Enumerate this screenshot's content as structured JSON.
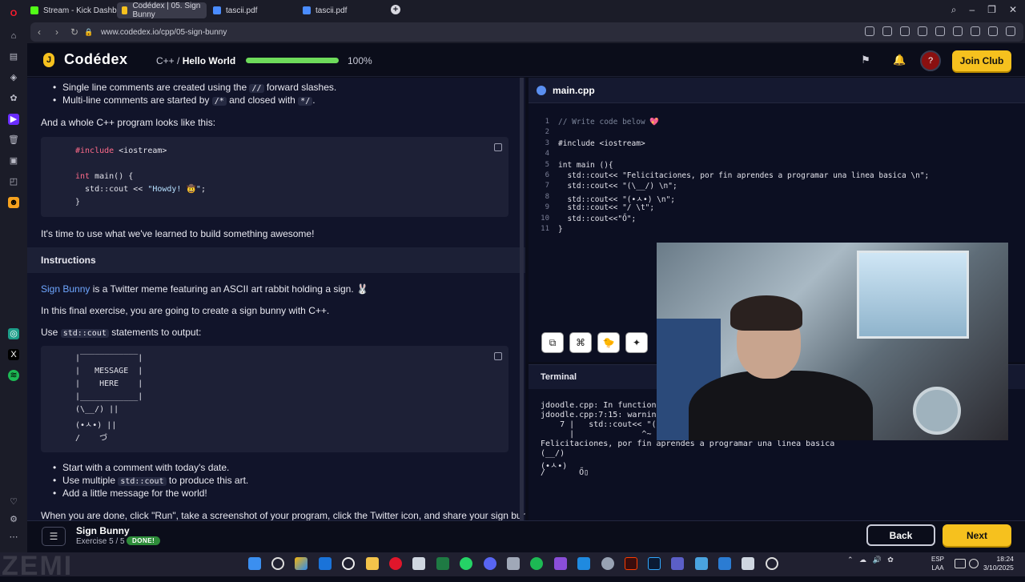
{
  "browser": {
    "tabs": [
      {
        "label": "Stream - Kick Dashboard"
      },
      {
        "label": "Codédex | 05. Sign Bunny"
      },
      {
        "label": "tascii.pdf"
      },
      {
        "label": "tascii.pdf"
      }
    ],
    "url": "www.codedex.io/cpp/05-sign-bunny"
  },
  "header": {
    "logo_badge": "J",
    "logo": "Codédex",
    "course": "C++",
    "separator": "/",
    "chapter": "Hello World",
    "progress_fraction": 1.0,
    "progress_label": "100%",
    "avatar": "?",
    "join_label": "Join Club"
  },
  "lesson": {
    "bullets_top": [
      {
        "pre": "Single line comments are created using the ",
        "code": "//",
        "post": " forward slashes."
      },
      {
        "pre": "Multi-line comments are started by ",
        "code": "/*",
        "mid": " and closed with ",
        "code2": "*/",
        "post": "."
      }
    ],
    "program_intro": "And a whole C++ program looks like this:",
    "program_code": [
      "#include <iostream>",
      "",
      "int main() {",
      "  std::cout << \"Howdy! 🤠\";",
      "}"
    ],
    "awesome": "It's time to use what we've learned to build something awesome!",
    "instructions_title": "Instructions",
    "sign_bunny_link": "Sign Bunny",
    "sign_bunny_text": " is a Twitter meme featuring an ASCII art rabbit holding a sign. 🐰",
    "final_exercise": "In this final exercise, you are going to create a sign bunny with C++.",
    "use_pre": "Use ",
    "use_code": "std::cout",
    "use_post": " statements to output:",
    "art": [
      "|‾‾‾‾‾‾‾‾‾‾‾‾|",
      "|   MESSAGE  |",
      "|    HERE    |",
      "|____________|",
      "(\\__/) ||",
      "(•ㅅ•) ||",
      "/    づ"
    ],
    "bullets_bottom": [
      {
        "pre": "Start with a comment with today's date."
      },
      {
        "pre": "Use multiple ",
        "code": "std::cout",
        "post": " to produce this art."
      },
      {
        "pre": "Add a little message for the world!"
      }
    ],
    "when_done": "When you are done, click \"Run\", take a screenshot of your program, click the Twitter icon, and share your sign bunny!"
  },
  "editor": {
    "filename": "main.cpp",
    "lines": [
      {
        "n": "1",
        "text": "// Write code below 💖",
        "comment": true
      },
      {
        "n": "2",
        "text": ""
      },
      {
        "n": "3",
        "text": "#include <iostream>"
      },
      {
        "n": "4",
        "text": ""
      },
      {
        "n": "5",
        "text": "int main (){"
      },
      {
        "n": "6",
        "text": "  std::cout<< \"Felicitaciones, por fin aprendes a programar una linea basica \\n\";"
      },
      {
        "n": "7",
        "text": "  std::cout<< \"(\\__/) \\n\";"
      },
      {
        "n": "8",
        "text": "  std::cout<< \"(•ㅅ•) \\n\";"
      },
      {
        "n": "9",
        "text": "  std::cout<< \"/ \\t\";"
      },
      {
        "n": "10",
        "text": "  std::cout<<\"Ő\";"
      },
      {
        "n": "11",
        "text": "}"
      }
    ],
    "tool_icons": [
      "copy-icon",
      "camera-icon",
      "duck-icon",
      "sparkle-icon"
    ]
  },
  "terminal": {
    "title": "Terminal",
    "lines": [
      "jdoodle.cpp: In function",
      "jdoodle.cpp:7:15: warning",
      "    7 |   std::cout<< \"(",
      "      |              ^~",
      "Felicitaciones, por fin aprendes a programar una linea basica",
      "(__/)",
      "(•ㅅ•)",
      "/       Ő▯"
    ]
  },
  "footer": {
    "exercise_title": "Sign Bunny",
    "exercise_sub": "Exercise 5 / 5",
    "done_badge": "DONE!",
    "back_label": "Back",
    "next_label": "Next"
  },
  "taskbar": {
    "lang_top": "ESP",
    "lang_bottom": "LAA",
    "time": "18:24",
    "date": "3/10/2025",
    "watermark": "ZEMI"
  },
  "colors": {
    "accent": "#f6c11e",
    "progress": "#6edb5b",
    "link": "#6ea6ff",
    "background": "#0b0d1a"
  }
}
